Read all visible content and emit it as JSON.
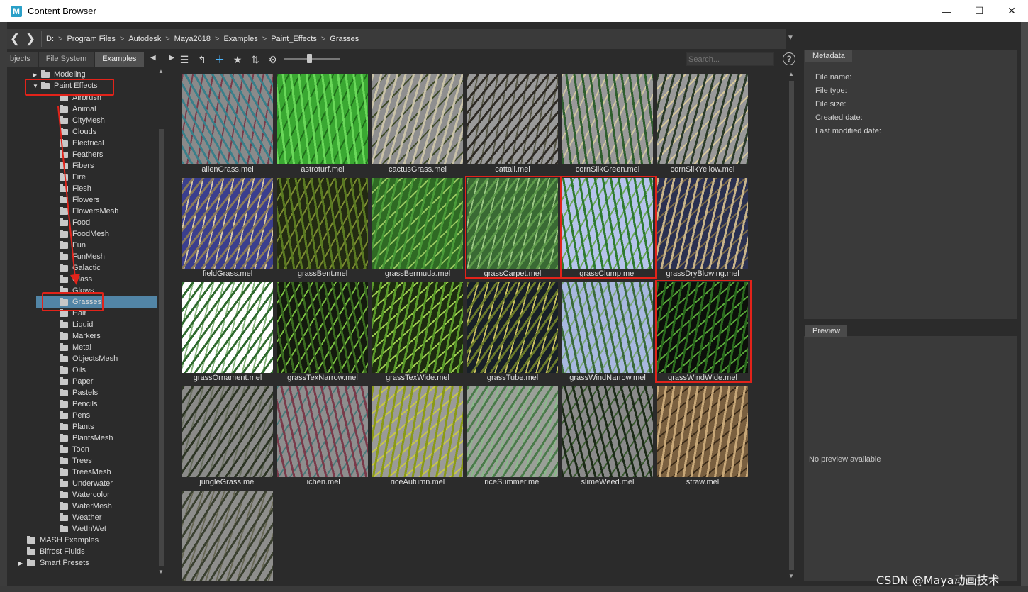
{
  "window": {
    "title": "Content Browser",
    "app_icon_letter": "M",
    "minimize": "—",
    "maximize": "☐",
    "close": "✕"
  },
  "path": {
    "back": "❮",
    "forward": "❯",
    "crumbs": [
      "D:",
      "Program Files",
      "Autodesk",
      "Maya2018",
      "Examples",
      "Paint_Effects",
      "Grasses"
    ],
    "separator": ">",
    "dropdown": "▼"
  },
  "tabs": [
    {
      "label": "bjects"
    },
    {
      "label": "File System"
    },
    {
      "label": "Examples",
      "active": true
    }
  ],
  "tab_arrows": "◀ ▶",
  "tree": {
    "top": [
      {
        "label": "Modeling",
        "expander": "▶"
      },
      {
        "label": "Paint Effects",
        "expander": "▼"
      }
    ],
    "children": [
      "Airbrush",
      "Animal",
      "CityMesh",
      "Clouds",
      "Electrical",
      "Feathers",
      "Fibers",
      "Fire",
      "Flesh",
      "Flowers",
      "FlowersMesh",
      "Food",
      "FoodMesh",
      "Fun",
      "FunMesh",
      "Galactic",
      "Glass",
      "Glows",
      "Grasses",
      "Hair",
      "Liquid",
      "Markers",
      "Metal",
      "ObjectsMesh",
      "Oils",
      "Paper",
      "Pastels",
      "Pencils",
      "Pens",
      "Plants",
      "PlantsMesh",
      "Toon",
      "Trees",
      "TreesMesh",
      "Underwater",
      "Watercolor",
      "WaterMesh",
      "Weather",
      "WetInWet"
    ],
    "bottom": [
      {
        "label": "MASH Examples",
        "expander": ""
      },
      {
        "label": "Bifrost Fluids",
        "expander": ""
      },
      {
        "label": "Smart Presets",
        "expander": "▶"
      }
    ],
    "selected": "Grasses"
  },
  "toolbar": {
    "list_icon": "☰",
    "up_icon": "↰",
    "new_folder_icon": "＋",
    "star_icon": "★",
    "sort_icon": "⇅",
    "gear_icon": "⚙",
    "zoom_level": 0.45,
    "search_placeholder": "Search...",
    "help": "?"
  },
  "files": [
    {
      "name": "alienGrass.mel",
      "colors": [
        "#8a8a8a",
        "#3a7f8a",
        "#7a3b4a"
      ]
    },
    {
      "name": "astroturf.mel",
      "colors": [
        "#3aa832",
        "#6ad85a",
        "#1f6e1a"
      ]
    },
    {
      "name": "cactusGrass.mel",
      "colors": [
        "#8f8f8f",
        "#c9c2a8",
        "#3e4a28"
      ]
    },
    {
      "name": "cattail.mel",
      "colors": [
        "#9a9a9a",
        "#2e2a24",
        "#5a5a4a"
      ]
    },
    {
      "name": "cornSilkGreen.mel",
      "colors": [
        "#999999",
        "#2e5e2e",
        "#cfc6a0"
      ]
    },
    {
      "name": "cornSilkYellow.mel",
      "colors": [
        "#999999",
        "#2a3a28",
        "#d6c79a"
      ]
    },
    {
      "name": "fieldGrass.mel",
      "colors": [
        "#3b3f8e",
        "#8a7a5a",
        "#d8c8a0"
      ]
    },
    {
      "name": "grassBent.mel",
      "colors": [
        "#232a12",
        "#5a7a22",
        "#7a8a30"
      ]
    },
    {
      "name": "grassBermuda.mel",
      "colors": [
        "#2f6a24",
        "#4a9a38",
        "#9ac860"
      ]
    },
    {
      "name": "grassCarpet.mel",
      "colors": [
        "#3a6a34",
        "#5e9a4a",
        "#9cc884"
      ]
    },
    {
      "name": "grassClump.mel",
      "colors": [
        "#b6c4ec",
        "#2e7a30",
        "#6aa85a"
      ]
    },
    {
      "name": "grassDryBlowing.mel",
      "colors": [
        "#2a3050",
        "#c8b48a",
        "#7a6a4a"
      ]
    },
    {
      "name": "grassOrnament.mel",
      "colors": [
        "#ffffff",
        "#2f6a2e",
        "#8ab880"
      ]
    },
    {
      "name": "grassTexNarrow.mel",
      "colors": [
        "#141a0e",
        "#3a6a20",
        "#7ac040"
      ]
    },
    {
      "name": "grassTexWide.mel",
      "colors": [
        "#1e2c10",
        "#5a9a2a",
        "#a0d050"
      ]
    },
    {
      "name": "grassTube.mel",
      "colors": [
        "#182028",
        "#6a7a2a",
        "#c8c060"
      ]
    },
    {
      "name": "grassWindNarrow.mel",
      "colors": [
        "#a8b8e0",
        "#3a6a3a",
        "#7aa87a"
      ]
    },
    {
      "name": "grassWindWide.mel",
      "colors": [
        "#0c100a",
        "#2a6a1e",
        "#5aa83a"
      ]
    },
    {
      "name": "jungleGrass.mel",
      "colors": [
        "#8a8a88",
        "#2c3424",
        "#6a7060"
      ]
    },
    {
      "name": "lichen.mel",
      "colors": [
        "#8e8e8e",
        "#7a3a4a",
        "#4a7a7a"
      ]
    },
    {
      "name": "riceAutumn.mel",
      "colors": [
        "#9a9a98",
        "#8a9a18",
        "#c8c848"
      ]
    },
    {
      "name": "riceSummer.mel",
      "colors": [
        "#9aa098",
        "#4a7a4a",
        "#8ab88a"
      ]
    },
    {
      "name": "slimeWeed.mel",
      "colors": [
        "#8a8a8a",
        "#1c2a18",
        "#3a5a30"
      ]
    },
    {
      "name": "straw.mel",
      "colors": [
        "#7a6040",
        "#c8a878",
        "#3a2a18"
      ]
    },
    {
      "name": "",
      "colors": [
        "#8e8e8c",
        "#3a4030",
        "#6a6a58"
      ]
    }
  ],
  "highlighted_files": [
    "grassCarpet.mel",
    "grassClump.mel",
    "grassWindWide.mel"
  ],
  "metadata": {
    "tab": "Metadata",
    "fields": [
      "File name:",
      "File type:",
      "File size:",
      "Created date:",
      "Last modified date:"
    ]
  },
  "preview": {
    "tab": "Preview",
    "empty_text": "No preview available"
  },
  "watermark": "CSDN @Maya动画技术"
}
